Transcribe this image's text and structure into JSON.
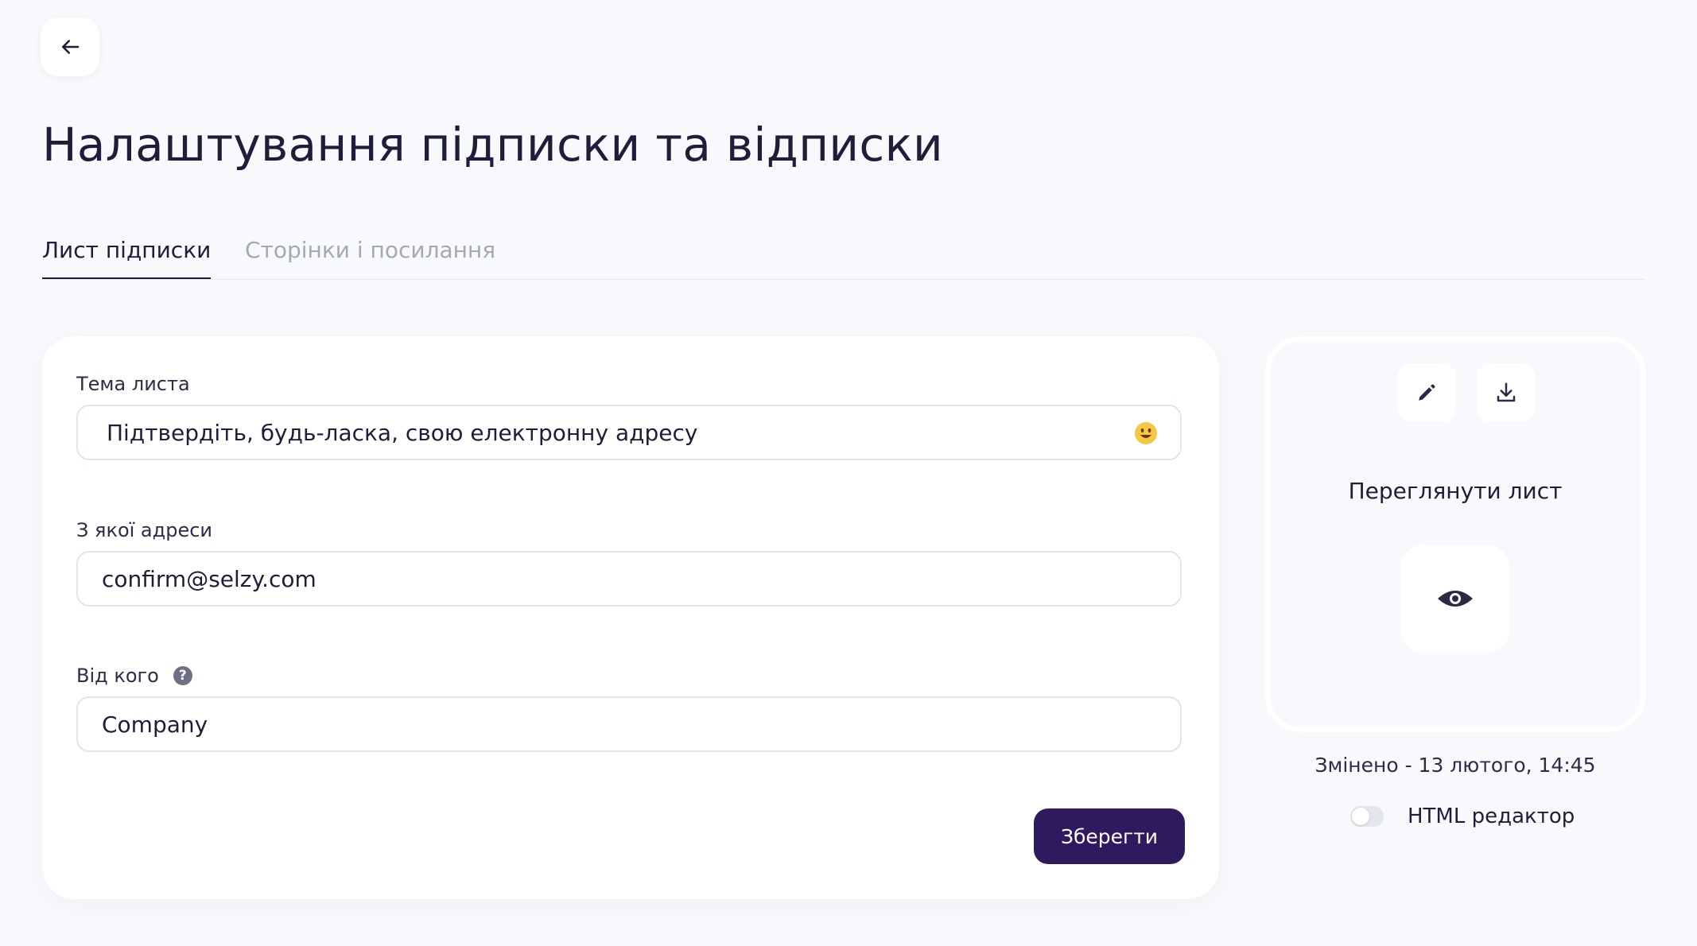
{
  "header": {
    "title": "Налаштування підписки та відписки"
  },
  "tabs": [
    {
      "label": "Лист підписки",
      "active": true
    },
    {
      "label": "Сторінки і посилання",
      "active": false
    }
  ],
  "form": {
    "subject": {
      "label": "Тема листа",
      "value": "Підтвердіть, будь-ласка, свою електронну адресу"
    },
    "from_address": {
      "label": "З якої адреси",
      "value": "confirm@selzy.com"
    },
    "from_name": {
      "label": "Від кого",
      "value": "Company"
    },
    "save_label": "Зберегти"
  },
  "preview": {
    "label": "Переглянути лист",
    "modified": "Змінено - 13 лютого, 14:45",
    "html_editor_label": "HTML редактор",
    "html_editor_enabled": false
  },
  "colors": {
    "primary": "#2f1a5f",
    "background": "#f8f9fc",
    "text": "#1f1d3a",
    "muted": "#a6a9b4"
  },
  "icons": {
    "back": "arrow-left-icon",
    "emoji": "smiley-icon",
    "help": "question-icon",
    "edit": "pencil-icon",
    "download": "download-icon",
    "view": "eye-icon"
  }
}
